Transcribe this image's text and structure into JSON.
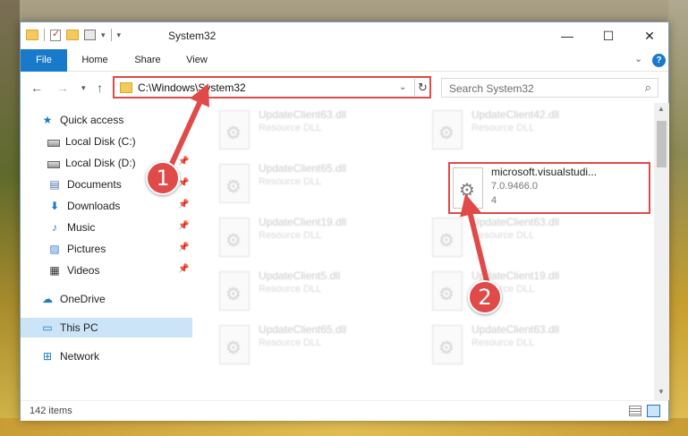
{
  "window": {
    "title": "System32",
    "controls": {
      "minimize": "—",
      "maximize": "☐",
      "close": "✕"
    }
  },
  "ribbon": {
    "tabs": [
      {
        "label": "File"
      },
      {
        "label": "Home"
      },
      {
        "label": "Share"
      },
      {
        "label": "View"
      }
    ],
    "help": "?"
  },
  "address_bar": {
    "path": "C:\\Windows\\System32",
    "search_placeholder": "Search System32"
  },
  "sidebar": {
    "items": [
      {
        "label": "Quick access",
        "icon": "star-icon"
      },
      {
        "label": "Local Disk (C:)",
        "icon": "drive-icon"
      },
      {
        "label": "Local Disk (D:)",
        "icon": "drive-icon"
      },
      {
        "label": "Documents",
        "icon": "documents-icon"
      },
      {
        "label": "Downloads",
        "icon": "download-icon"
      },
      {
        "label": "Music",
        "icon": "music-icon"
      },
      {
        "label": "Pictures",
        "icon": "pictures-icon"
      },
      {
        "label": "Videos",
        "icon": "videos-icon"
      },
      {
        "label": "OneDrive",
        "icon": "cloud-icon"
      },
      {
        "label": "This PC",
        "icon": "computer-icon",
        "selected": true
      },
      {
        "label": "Network",
        "icon": "network-icon"
      }
    ]
  },
  "files": [
    {
      "name": "UpdateClient63.dll",
      "type": "Resource DLL"
    },
    {
      "name": "UpdateClient42.dll",
      "type": "Resource DLL"
    },
    {
      "name": "UpdateClient65.dll",
      "type": "Resource DLL"
    },
    {
      "name": "UpdateClient19.dll",
      "type": "Resource DLL"
    },
    {
      "name": "UpdateClient63.dll",
      "type": "Resource DLL"
    },
    {
      "name": "UpdateClient5.dll",
      "type": "Resource DLL"
    },
    {
      "name": "UpdateClient19.dll",
      "type": "Resource DLL"
    },
    {
      "name": "UpdateClient65.dll",
      "type": "Resource DLL"
    },
    {
      "name": "UpdateClient63.dll",
      "type": "Resource DLL"
    }
  ],
  "highlighted_file": {
    "name": "microsoft.visualstudi...",
    "version": "7.0.9466.0",
    "extra": "4"
  },
  "status": {
    "item_count": "142 items"
  },
  "callouts": {
    "one": "1",
    "two": "2"
  },
  "colors": {
    "accent": "#1979ca",
    "highlight": "#e04a48"
  }
}
